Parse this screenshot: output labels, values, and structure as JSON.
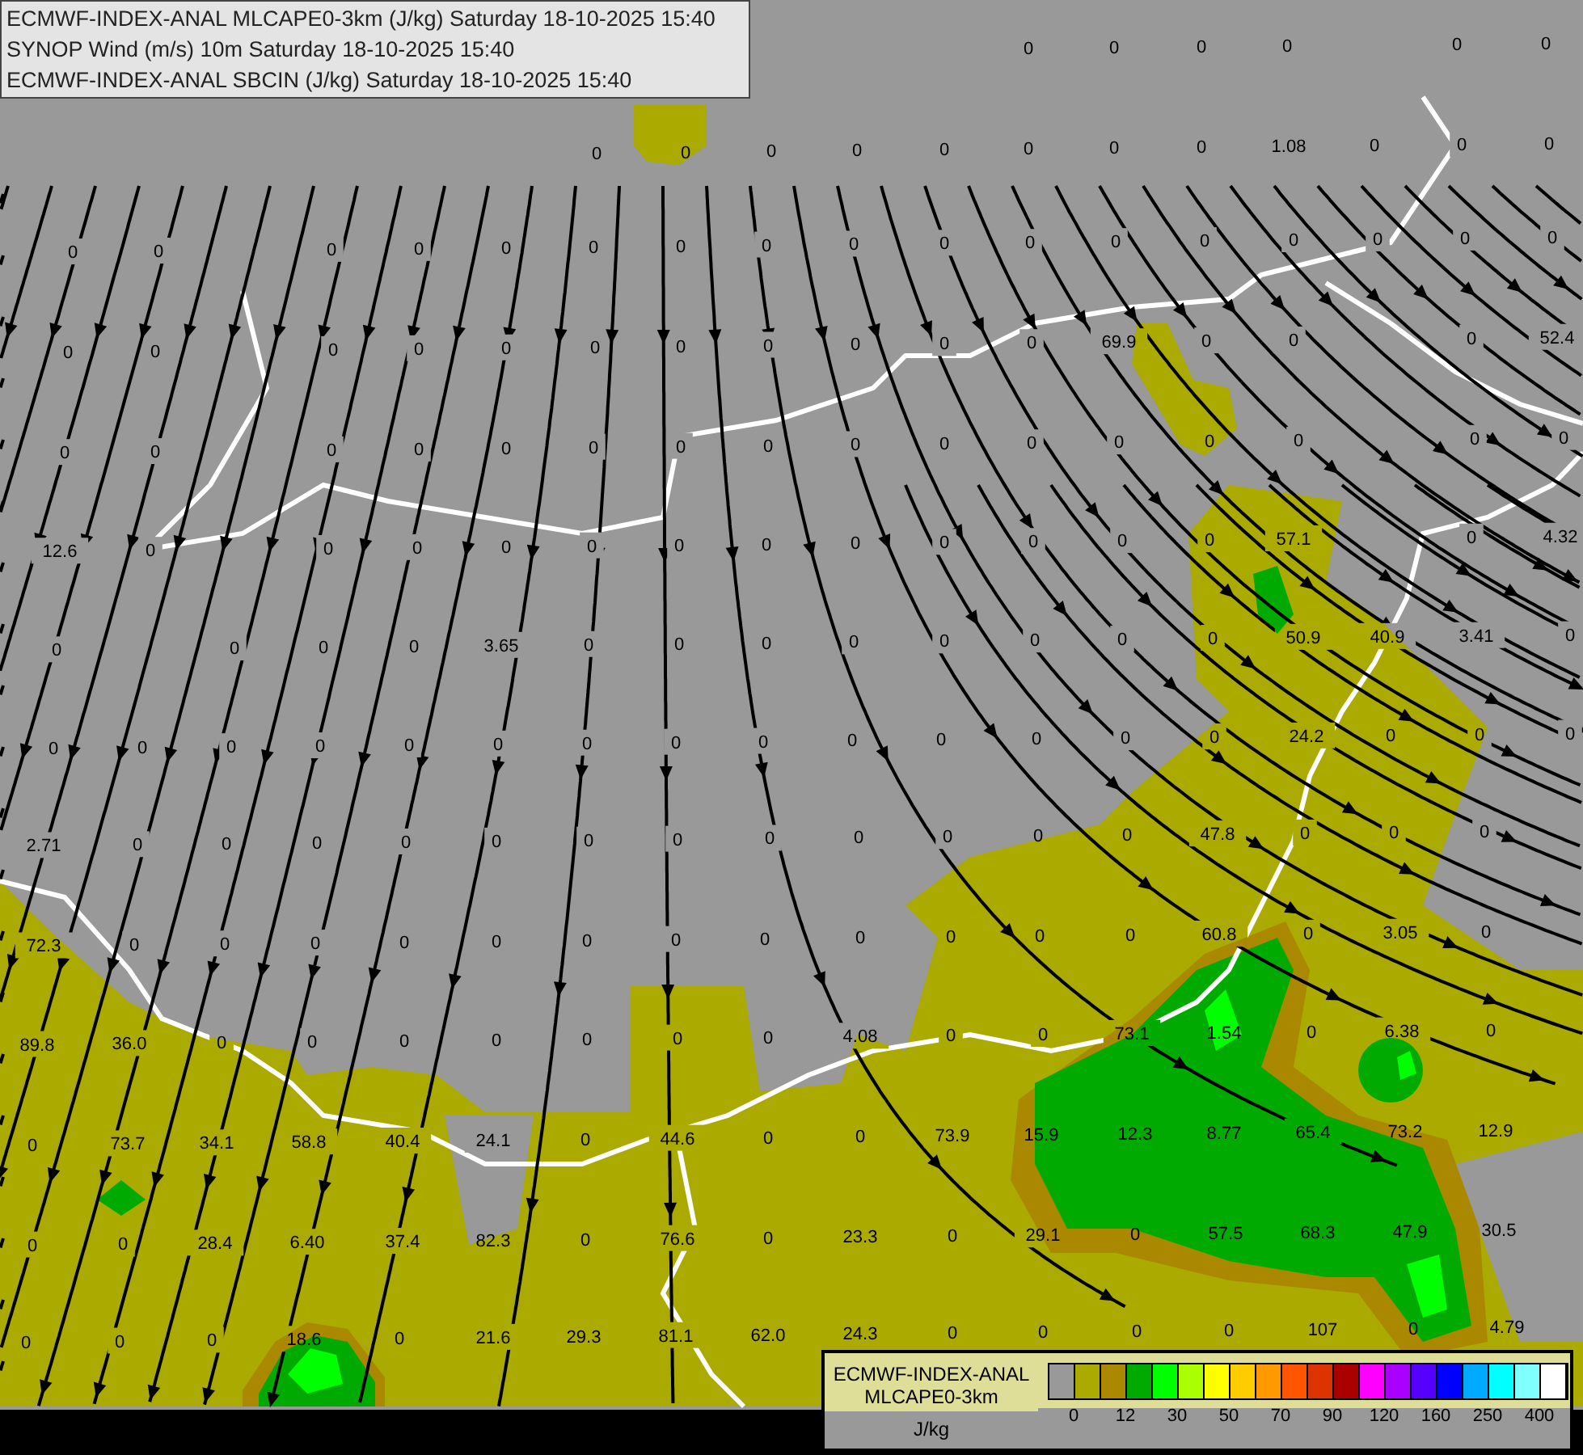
{
  "title_box": {
    "lines": [
      "ECMWF-INDEX-ANAL MLCAPE0-3km (J/kg) Saturday 18-10-2025 15:40",
      "SYNOP Wind (m/s) 10m Saturday 18-10-2025 15:40",
      "ECMWF-INDEX-ANAL SBCIN (J/kg) Saturday 18-10-2025 15:40"
    ]
  },
  "map": {
    "value_label_rows": [
      [
        "0",
        "0",
        "0",
        "0",
        "0",
        "0"
      ],
      [
        "0",
        "0",
        "0",
        "0",
        "0",
        "0",
        "0",
        "0",
        "1.08",
        "0",
        "0",
        "0"
      ],
      [
        "0",
        "0",
        "0",
        "0",
        "0",
        "0",
        "0",
        "0",
        "0",
        "0",
        "0",
        "0",
        "0",
        "0",
        "0",
        "0",
        "0"
      ],
      [
        "0",
        "0",
        "0",
        "0",
        "0",
        "0",
        "0",
        "0",
        "0",
        "0",
        "0",
        "69.9",
        "0",
        "0",
        "0",
        "52.4"
      ],
      [
        "0",
        "0",
        "0",
        "0",
        "0",
        "0",
        "0",
        "0",
        "0",
        "0",
        "0",
        "0",
        "0",
        "0",
        "0",
        "0"
      ],
      [
        "12.6",
        "0",
        "0",
        "0",
        "0",
        "0",
        "0",
        "0",
        "0",
        "0",
        "0",
        "0",
        "0",
        "57.1",
        "0",
        "4.32"
      ],
      [
        "0",
        "0",
        "0",
        "0",
        "3.65",
        "0",
        "0",
        "0",
        "0",
        "0",
        "0",
        "0",
        "0",
        "50.9",
        "40.9",
        "3.41",
        "0"
      ],
      [
        "0",
        "0",
        "0",
        "0",
        "0",
        "0",
        "0",
        "0",
        "0",
        "0",
        "0",
        "0",
        "0",
        "0",
        "24.2",
        "0",
        "0",
        "0"
      ],
      [
        "2.71",
        "0",
        "0",
        "0",
        "0",
        "0",
        "0",
        "0",
        "0",
        "0",
        "0",
        "0",
        "0",
        "47.8",
        "0",
        "0",
        "0"
      ],
      [
        "72.3",
        "0",
        "0",
        "0",
        "0",
        "0",
        "0",
        "0",
        "0",
        "0",
        "0",
        "0",
        "0",
        "60.8",
        "0",
        "3.05",
        "0"
      ],
      [
        "89.8",
        "36.0",
        "0",
        "0",
        "0",
        "0",
        "0",
        "0",
        "0",
        "4.08",
        "0",
        "0",
        "73.1",
        "1.54",
        "0",
        "6.38",
        "0"
      ],
      [
        "0",
        "73.7",
        "34.1",
        "58.8",
        "40.4",
        "24.1",
        "0",
        "44.6",
        "0",
        "0",
        "73.9",
        "15.9",
        "12.3",
        "8.77",
        "65.4",
        "73.2",
        "12.9"
      ],
      [
        "0",
        "0",
        "28.4",
        "6.40",
        "37.4",
        "82.3",
        "0",
        "76.6",
        "0",
        "23.3",
        "0",
        "29.1",
        "0",
        "57.5",
        "68.3",
        "47.9",
        "30.5"
      ],
      [
        "0",
        "0",
        "0",
        "18.6",
        "0",
        "21.6",
        "29.3",
        "81.1",
        "62.0",
        "24.3",
        "0",
        "0",
        "0",
        "0",
        "107",
        "0",
        "4.79"
      ]
    ]
  },
  "legend": {
    "title_lines": [
      "ECMWF-INDEX-ANAL",
      "MLCAPE0-3km"
    ],
    "unit": "J/kg",
    "swatches": [
      {
        "color": "#999999"
      },
      {
        "color": "#aaaa00"
      },
      {
        "color": "#aa8800"
      },
      {
        "color": "#00aa00"
      },
      {
        "color": "#00ff00"
      },
      {
        "color": "#aaff00"
      },
      {
        "color": "#ffff00"
      },
      {
        "color": "#ffcc00"
      },
      {
        "color": "#ff9900"
      },
      {
        "color": "#ff5500"
      },
      {
        "color": "#dd3300"
      },
      {
        "color": "#aa0000"
      },
      {
        "color": "#ff00ff"
      },
      {
        "color": "#aa00ff"
      },
      {
        "color": "#5500ff"
      },
      {
        "color": "#0000ff"
      },
      {
        "color": "#00aaff"
      },
      {
        "color": "#00ffff"
      },
      {
        "color": "#80ffff"
      },
      {
        "color": "#ffffff"
      }
    ],
    "tick_labels": [
      "0",
      "12",
      "30",
      "50",
      "70",
      "90",
      "120",
      "160",
      "250",
      "400"
    ]
  }
}
